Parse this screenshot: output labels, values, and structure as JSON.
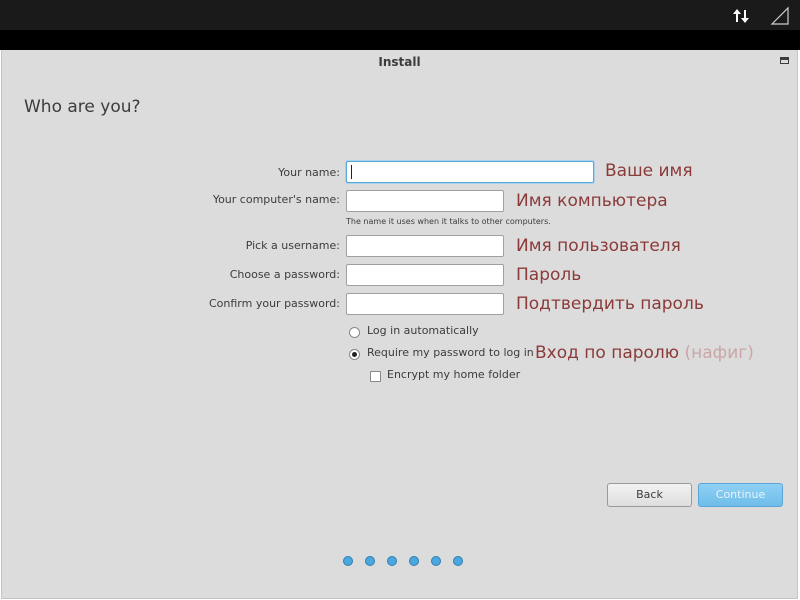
{
  "window": {
    "title": "Install"
  },
  "page": {
    "title": "Who are you?"
  },
  "form": {
    "name_label": "Your name:",
    "name_value": "",
    "computer_label": "Your computer's name:",
    "computer_value": "",
    "computer_hint": "The name it uses when it talks to other computers.",
    "username_label": "Pick a username:",
    "username_value": "",
    "password_label": "Choose a password:",
    "password_value": "",
    "confirm_label": "Confirm your password:",
    "confirm_value": ""
  },
  "options": {
    "autologin_label": "Log in automatically",
    "autologin_selected": false,
    "require_password_label": "Require my password to log in",
    "require_password_selected": true,
    "encrypt_label": "Encrypt my home folder",
    "encrypt_checked": false
  },
  "annotations": {
    "name": "Ваше имя",
    "computer": "Имя компьютера",
    "username": "Имя пользователя",
    "password": "Пароль",
    "confirm": "Подтвердить пароль",
    "login_main": "Вход по паролю",
    "login_muted": "(нафиг)"
  },
  "buttons": {
    "back": "Back",
    "continue": "Continue",
    "continue_enabled": false
  },
  "progress": {
    "steps": 6
  },
  "colors": {
    "accent": "#5aa7d8",
    "annotation": "#8b3a3a",
    "annotation_muted": "#caa6a6"
  },
  "icons": {
    "status_network": "network-transfer-icon",
    "status_signal": "signal-icon",
    "window_maximize": "maximize-icon"
  }
}
